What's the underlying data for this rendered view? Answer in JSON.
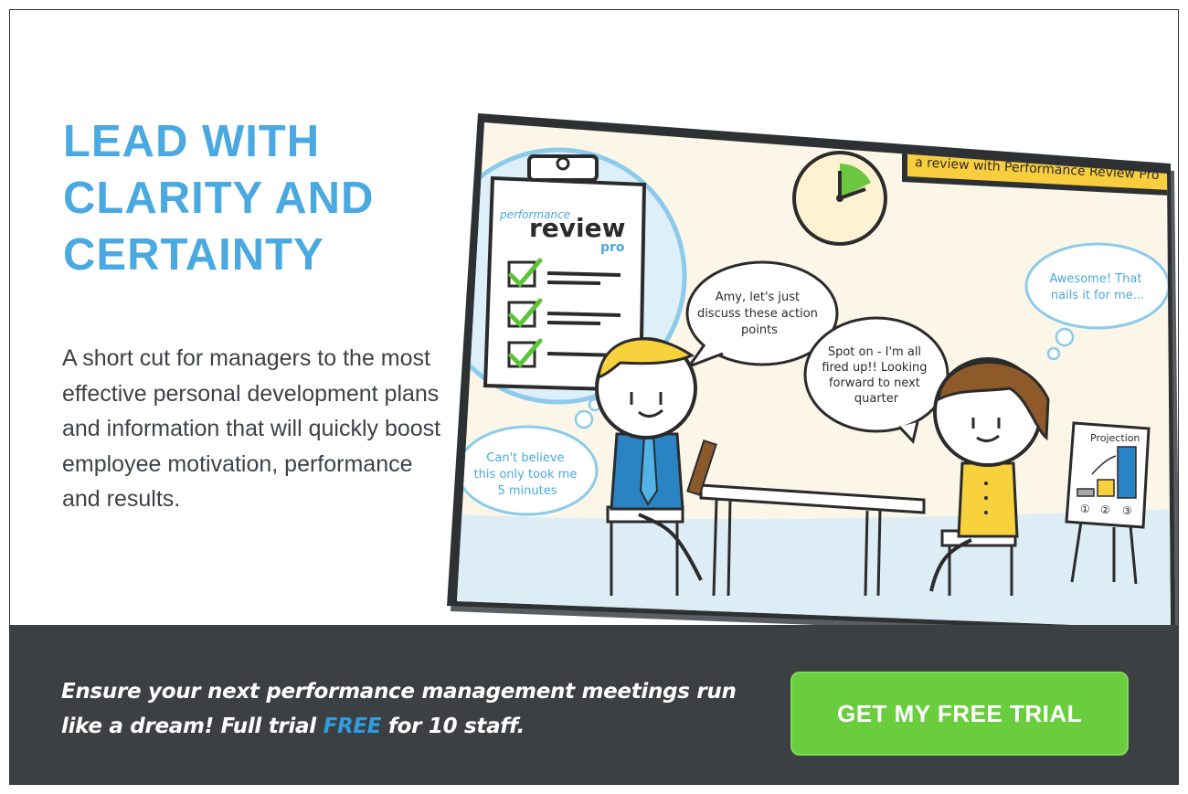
{
  "headline": {
    "line1": "LEAD WITH",
    "line2": "CLARITY AND",
    "line3": "CERTAINTY"
  },
  "subtext": "A short cut for managers to the most effective personal development plans and information that will quickly boost employee motivation, performance and results.",
  "illustration": {
    "banner": "a review with Performance Review Pro",
    "clipboard_small": "performance",
    "clipboard_big": "review",
    "clipboard_pro": "pro",
    "bubble_manager": [
      "Amy, let's just",
      "discuss these action",
      "points"
    ],
    "bubble_employee": [
      "Spot on - I'm all",
      "fired up!! Looking",
      "forward to next",
      "quarter"
    ],
    "thought_manager": [
      "Can't believe",
      "this only took me",
      "5 minutes"
    ],
    "thought_employee": [
      "Awesome! That",
      "nails it for me..."
    ],
    "chart_title": "Projection",
    "chart_ticks": [
      "①",
      "②",
      "③"
    ]
  },
  "cta": {
    "text_before": "Ensure your next performance management meetings run like a dream! Full trial ",
    "text_free": "FREE",
    "text_after": " for 10 staff.",
    "button": "GET MY FREE TRIAL"
  },
  "colors": {
    "accent_blue": "#49a9e0",
    "button_green": "#6acd3e",
    "footer_dark": "#3d4043",
    "banner_yellow": "#f8cd3e"
  }
}
